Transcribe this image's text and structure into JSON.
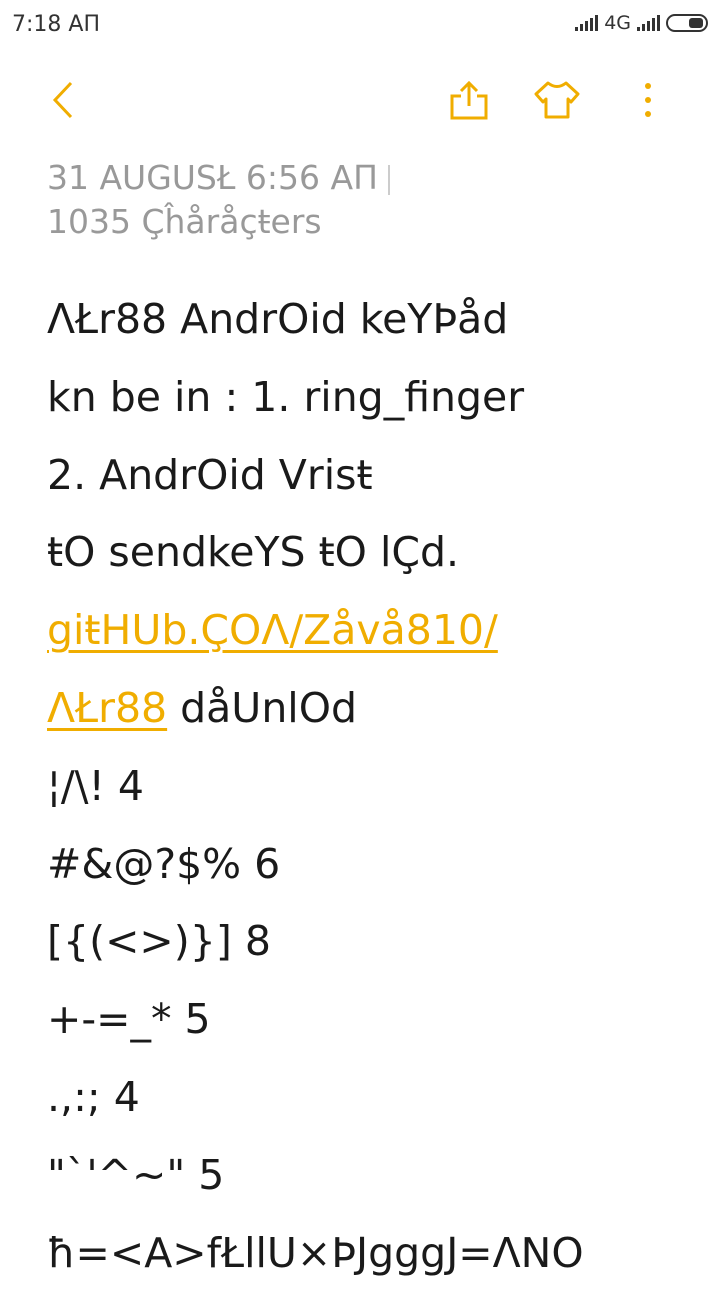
{
  "status_bar": {
    "time": "7:18 AΠ",
    "network": "4G"
  },
  "toolbar": {
    "back_icon": "chevron-left-icon",
    "share_icon": "share-icon",
    "theme_icon": "shirt-icon",
    "more_icon": "more-vertical-icon",
    "accent": "#f0ad00"
  },
  "note": {
    "date": "31 AUGUSŁ  6:56 AΠ",
    "char_count": "1035 Çĥåråçŧers",
    "lines": [
      {
        "text": "ΛŁr88 AndrOid keYÞåd"
      },
      {
        "text": "kn be in : 1. ring_finger"
      },
      {
        "text": "2. AndrOid Vrisŧ"
      },
      {
        "text": "ŧO sendkeYS ŧO lÇd."
      },
      {
        "link": "giŧHUb.ÇOΛ/Zåvå810/"
      },
      {
        "link": "ΛŁr88",
        "text": " dåUnlOd"
      },
      {
        "text": "¦/\\! 4"
      },
      {
        "text": "#&@?$% 6"
      },
      {
        "text": "[{(<>)}] 8"
      },
      {
        "text": "+-=_* 5"
      },
      {
        "text": ".,:; 4"
      },
      {
        "text": "\"`'^~\" 5"
      },
      {
        "text": "ħ=<A>fŁllU×ÞJgggJ=ΛNO"
      }
    ]
  }
}
